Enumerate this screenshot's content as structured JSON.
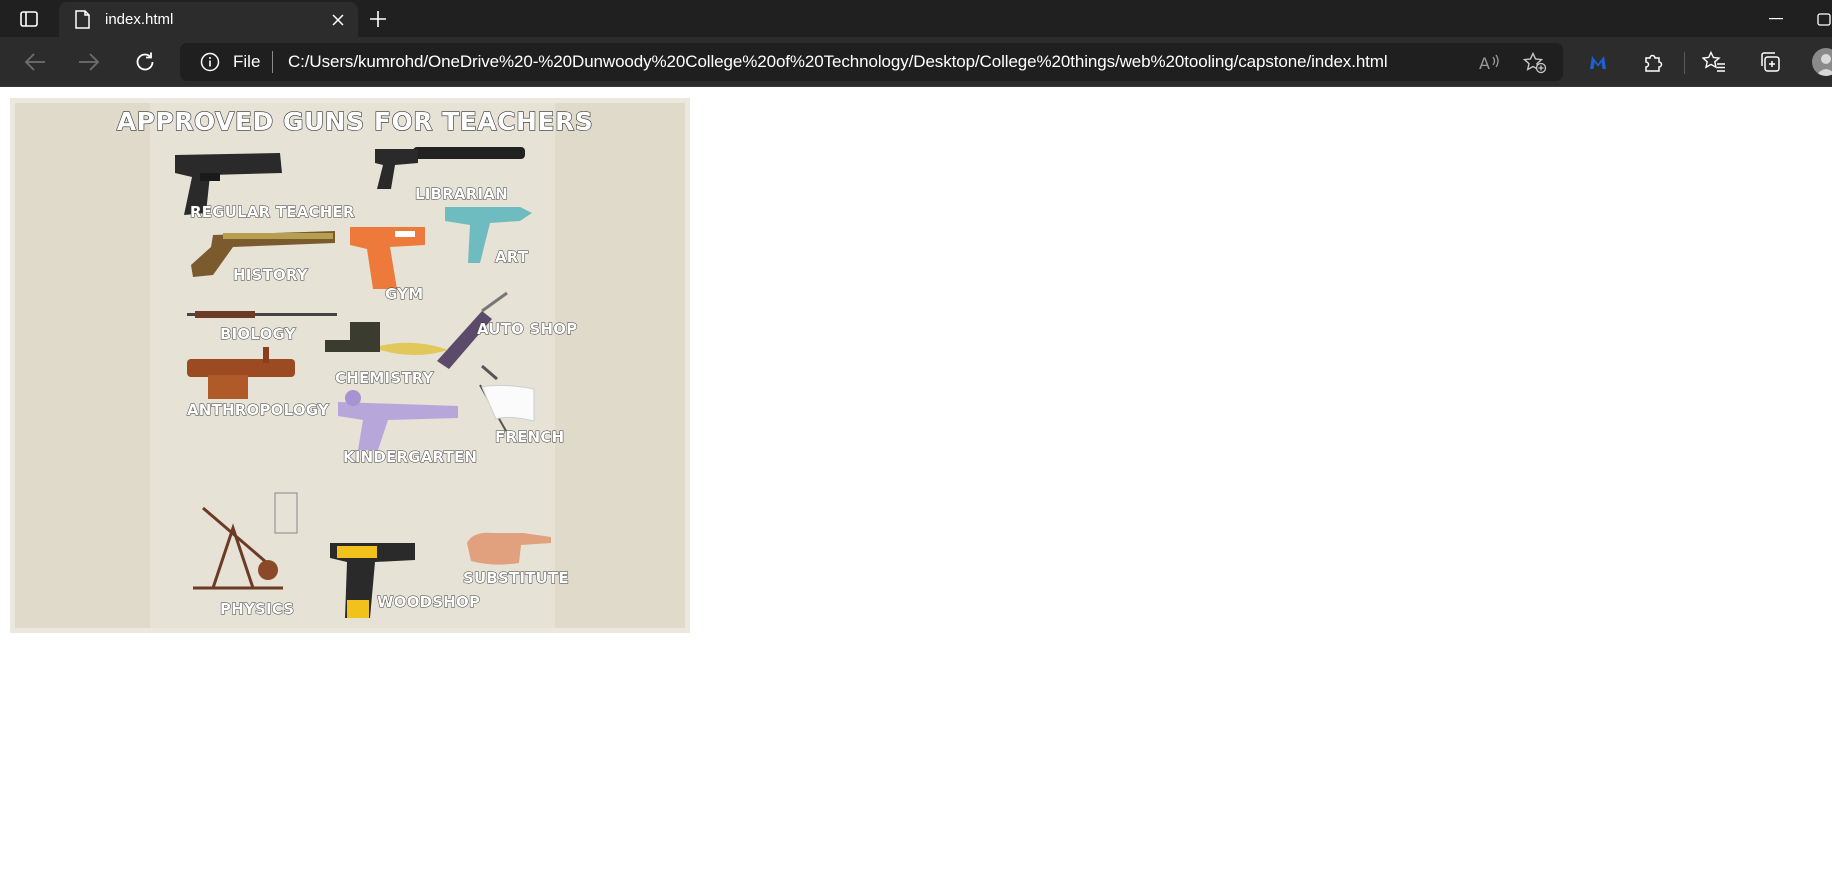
{
  "browser": {
    "tab": {
      "title": "index.html"
    },
    "address": {
      "scheme": "File",
      "url": "C:/Users/kumrohd/OneDrive%20-%20Dunwoody%20College%20of%20Technology/Desktop/College%20things/web%20tooling/capstone/index.html"
    },
    "icons": {
      "tab_actions": "tab-actions-icon",
      "favicon": "page-icon",
      "close": "close-icon",
      "new_tab": "plus-icon",
      "back": "back-arrow-icon",
      "forward": "forward-arrow-icon",
      "refresh": "refresh-icon",
      "info": "info-icon",
      "read_aloud": "read-aloud-icon",
      "add_favorite": "add-favorite-icon",
      "extension_malwarebytes": "malwarebytes-icon",
      "extensions": "puzzle-icon",
      "favorites": "favorites-icon",
      "collections": "collections-icon",
      "profile": "avatar"
    },
    "colors": {
      "tabstrip": "#202020",
      "toolbar": "#2c2c2c",
      "address_bg": "#1f1f1f",
      "accent_malwarebytes": "#1c5fd6"
    }
  },
  "poster": {
    "title": "APPROVED GUNS FOR TEACHERS",
    "labels": {
      "regular_teacher": "REGULAR TEACHER",
      "librarian": "LIBRARIAN",
      "history": "HISTORY",
      "gym": "GYM",
      "art": "ART",
      "biology": "BIOLOGY",
      "auto_shop": "AUTO SHOP",
      "chemistry": "CHEMISTRY",
      "anthropology": "ANTHROPOLOGY",
      "kindergarten": "KINDERGARTEN",
      "french": "FRENCH",
      "physics": "PHYSICS",
      "woodshop": "WOODSHOP",
      "substitute": "SUBSTITUTE"
    }
  }
}
